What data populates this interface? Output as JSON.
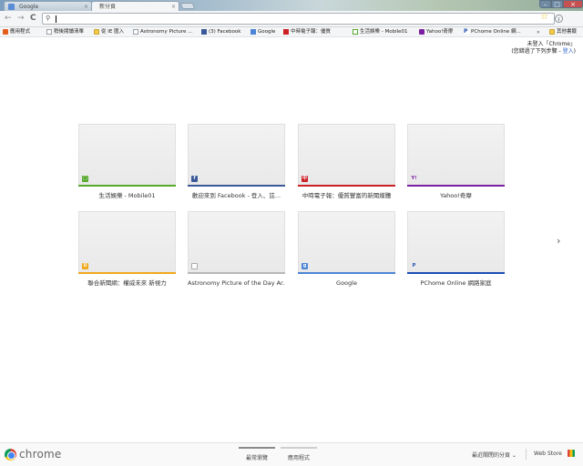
{
  "tabs": [
    {
      "title": "Google",
      "active": false
    },
    {
      "title": "新分頁",
      "active": true
    }
  ],
  "toolbar": {
    "back": "←",
    "forward": "→",
    "reload": "C",
    "omnibox_value": "",
    "star": "☆"
  },
  "bookmarks": [
    {
      "label": "應用程式",
      "icon": "apps-icon"
    },
    {
      "label": "稍後閱讀清單",
      "icon": "page-icon"
    },
    {
      "label": "從 IE 匯入",
      "icon": "folder-icon"
    },
    {
      "label": "Astronomy Picture ...",
      "icon": "page-icon"
    },
    {
      "label": "(3) Facebook",
      "icon": "facebook-icon"
    },
    {
      "label": "Google",
      "icon": "google-icon"
    },
    {
      "label": "中時電子報：優質",
      "icon": "chinatimes-icon"
    },
    {
      "label": "生活娛樂 - Mobile01",
      "icon": "mobile01-icon"
    },
    {
      "label": "Yahoo!奇摩",
      "icon": "yahoo-icon"
    },
    {
      "label": "PChome Online 網...",
      "icon": "pchome-icon"
    }
  ],
  "bookmarks_more": "»",
  "other_bookmarks": "其他書籤",
  "signin": {
    "line1": "未登入「Chrome」",
    "line2_prefix": "(您錯過了下列步驟 - ",
    "link": "登入",
    "line2_suffix": ")"
  },
  "most_visited": [
    {
      "title": "生活娛樂 - Mobile01",
      "color": "#56a92a",
      "favicon": "mobile01-icon",
      "glyph": "□"
    },
    {
      "title": "歡迎來到 Facebook - 登入、註...",
      "color": "#3b5998",
      "favicon": "facebook-icon",
      "glyph": "f"
    },
    {
      "title": "中時電子報：優質豐富的新聞媒體",
      "color": "#cc2026",
      "favicon": "chinatimes-icon",
      "glyph": "中"
    },
    {
      "title": "Yahoo!奇摩",
      "color": "#7b1fa2",
      "favicon": "yahoo-icon",
      "glyph": "Y!"
    },
    {
      "title": "聯合新聞網：權威未來 新視力",
      "color": "#f0a81c",
      "favicon": "udn-icon",
      "glyph": "U"
    },
    {
      "title": "Astronomy Picture of the Day Ar...",
      "color": "#b8b8b8",
      "favicon": "page-icon",
      "glyph": ""
    },
    {
      "title": "Google",
      "color": "#4d84d6",
      "favicon": "google-icon",
      "glyph": "g"
    },
    {
      "title": "PChome Online 網路家庭",
      "color": "#1a4db3",
      "favicon": "pchome-icon",
      "glyph": "P"
    }
  ],
  "next_page": "›",
  "footer": {
    "logo_text": "chrome",
    "tab_most_visited": "最常瀏覽",
    "tab_apps": "應用程式",
    "recently_closed": "最近關閉的分頁 ⌄",
    "web_store": "Web Store"
  }
}
